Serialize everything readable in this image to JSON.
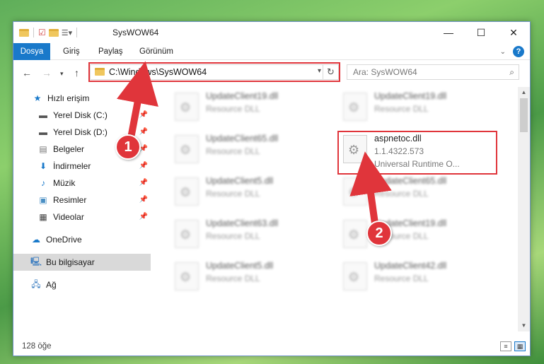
{
  "window": {
    "title": "SysWOW64",
    "controls": {
      "minimize": "—",
      "maximize": "☐",
      "close": "✕"
    }
  },
  "ribbon": {
    "tabs": [
      "Dosya",
      "Giriş",
      "Paylaş",
      "Görünüm"
    ]
  },
  "address": {
    "path": "C:\\Windows\\SysWOW64",
    "search_placeholder": "Ara: SysWOW64"
  },
  "nav": {
    "items": [
      {
        "label": "Hızlı erişim",
        "icon": "star-icon",
        "pinned": false
      },
      {
        "label": "Yerel Disk (C:)",
        "icon": "drive-icon",
        "pinned": true
      },
      {
        "label": "Yerel Disk (D:)",
        "icon": "drive-icon",
        "pinned": true
      },
      {
        "label": "Belgeler",
        "icon": "documents-icon",
        "pinned": true
      },
      {
        "label": "İndirmeler",
        "icon": "download-icon",
        "pinned": true
      },
      {
        "label": "Müzik",
        "icon": "music-icon",
        "pinned": true
      },
      {
        "label": "Resimler",
        "icon": "pictures-icon",
        "pinned": true
      },
      {
        "label": "Videolar",
        "icon": "videos-icon",
        "pinned": true
      },
      {
        "label": "OneDrive",
        "icon": "cloud-icon",
        "pinned": false
      },
      {
        "label": "Bu bilgisayar",
        "icon": "computer-icon",
        "pinned": false,
        "selected": true
      },
      {
        "label": "Ağ",
        "icon": "network-icon",
        "pinned": false
      }
    ]
  },
  "files": [
    {
      "name": "UpdateClient19.dll",
      "type": "Resource DLL"
    },
    {
      "name": "UpdateClient19.dll",
      "type": "Resource DLL"
    },
    {
      "name": "UpdateClient65.dll",
      "type": "Resource DLL"
    },
    {
      "name": "aspnetoc.dll",
      "version": "1.1.4322.573",
      "type": "Universal Runtime O...",
      "highlighted": true
    },
    {
      "name": "UpdateClient5.dll",
      "type": "Resource DLL"
    },
    {
      "name": "UpdateClient65.dll",
      "type": "Resource DLL"
    },
    {
      "name": "UpdateClient63.dll",
      "type": "Resource DLL"
    },
    {
      "name": "UpdateClient19.dll",
      "type": "Resource DLL"
    },
    {
      "name": "UpdateClient5.dll",
      "type": "Resource DLL"
    },
    {
      "name": "UpdateClient42.dll",
      "type": "Resource DLL"
    }
  ],
  "status": {
    "count": "128 öğe"
  },
  "annotations": {
    "badge1": "1",
    "badge2": "2",
    "color": "#e0353b"
  }
}
